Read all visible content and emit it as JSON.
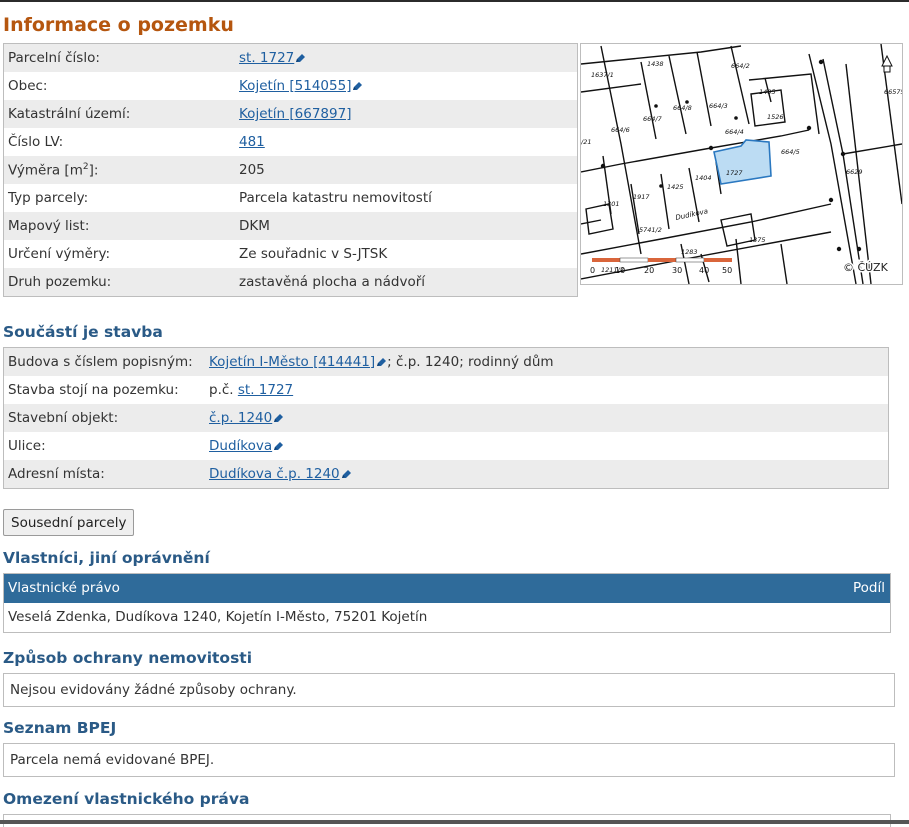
{
  "page": {
    "title": "Informace o pozemku"
  },
  "parcel_info": [
    {
      "label": "Parcelní číslo:",
      "value": "st. 1727",
      "link": true,
      "edit_icon": true
    },
    {
      "label": "Obec:",
      "value": "Kojetín [514055]",
      "link": true,
      "edit_icon": true
    },
    {
      "label": "Katastrální území:",
      "value": "Kojetín [667897]",
      "link": true,
      "edit_icon": false
    },
    {
      "label": "Číslo LV:",
      "value": "481",
      "link": true,
      "edit_icon": false
    },
    {
      "label_prefix": "Výměra [m",
      "label_sup": "2",
      "label_suffix": "]:",
      "value": "205",
      "link": false
    },
    {
      "label": "Typ parcely:",
      "value": "Parcela katastru nemovitostí",
      "link": false
    },
    {
      "label": "Mapový list:",
      "value": "DKM",
      "link": false
    },
    {
      "label": "Určení výměry:",
      "value": "Ze souřadnic v S-JTSK",
      "link": false
    },
    {
      "label": "Druh pozemku:",
      "value": "zastavěná plocha a nádvoří",
      "link": false
    }
  ],
  "map": {
    "copyright": "© ČÚZK",
    "street_label": "Dudíkova",
    "parcel_labels": [
      "1637/1",
      "1438",
      "664/2",
      "664/6",
      "664/7",
      "664/8",
      "664/3",
      "1405",
      "1526",
      "664/4",
      "664/5",
      "1727",
      "1404",
      "1425",
      "1917",
      "1301",
      "5741/2",
      "1283",
      "1375",
      "6629",
      "66575",
      "/21",
      "1211/2"
    ],
    "scale_labels": [
      "0",
      "10",
      "20",
      "30",
      "40",
      "50"
    ],
    "highlight_color": "#bcdcf3"
  },
  "building": {
    "heading": "Součástí je stavba",
    "rows": [
      {
        "label": "Budova s číslem popisným:",
        "link": "Kojetín I-Město [414441]",
        "after": "; č.p. 1240; rodinný dům"
      },
      {
        "label": "Stavba stojí na pozemku:",
        "before": "p.č. ",
        "link": "st. 1727"
      },
      {
        "label": "Stavební objekt:",
        "link": "č.p. 1240"
      },
      {
        "label": "Ulice:",
        "link": "Dudíkova"
      },
      {
        "label": "Adresní místa:",
        "link": "Dudíkova č.p. 1240"
      }
    ]
  },
  "neighbors_button": "Sousední parcely",
  "owners": {
    "heading": "Vlastníci, jiní oprávnění",
    "col_left": "Vlastnické právo",
    "col_right": "Podíl",
    "row": "Veselá Zdenka, Dudíkova 1240, Kojetín I-Město, 75201 Kojetín"
  },
  "protection": {
    "heading": "Způsob ochrany nemovitosti",
    "text": "Nejsou evidovány žádné způsoby ochrany."
  },
  "bpej": {
    "heading": "Seznam BPEJ",
    "text": "Parcela nemá evidované BPEJ."
  },
  "restrictions": {
    "heading": "Omezení vlastnického práva"
  },
  "colors": {
    "title": "#b5560f",
    "heading": "#2a5a86",
    "link": "#1f5fa0",
    "table_header": "#2f6b9a"
  }
}
